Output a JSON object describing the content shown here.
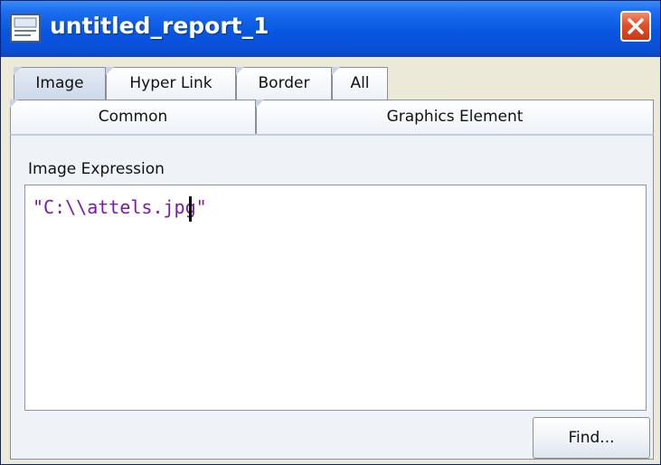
{
  "window": {
    "title": "untitled_report_1",
    "title_color": "#0856e0",
    "close_color": "#e0502c"
  },
  "tabs_row1": [
    {
      "label": "Image",
      "active": true
    },
    {
      "label": "Hyper Link",
      "active": false
    },
    {
      "label": "Border",
      "active": false
    },
    {
      "label": "All",
      "active": false
    }
  ],
  "tabs_row2": [
    {
      "label": "Common",
      "active": false
    },
    {
      "label": "Graphics Element",
      "active": false
    }
  ],
  "image_expression": {
    "label": "Image Expression",
    "value": "\"C:\\\\attels.jpg\"",
    "text_color": "#7a1aa6"
  },
  "buttons": {
    "find_label": "Find..."
  },
  "icons": {
    "window_icon": "report-icon",
    "close_icon": "close-icon"
  }
}
